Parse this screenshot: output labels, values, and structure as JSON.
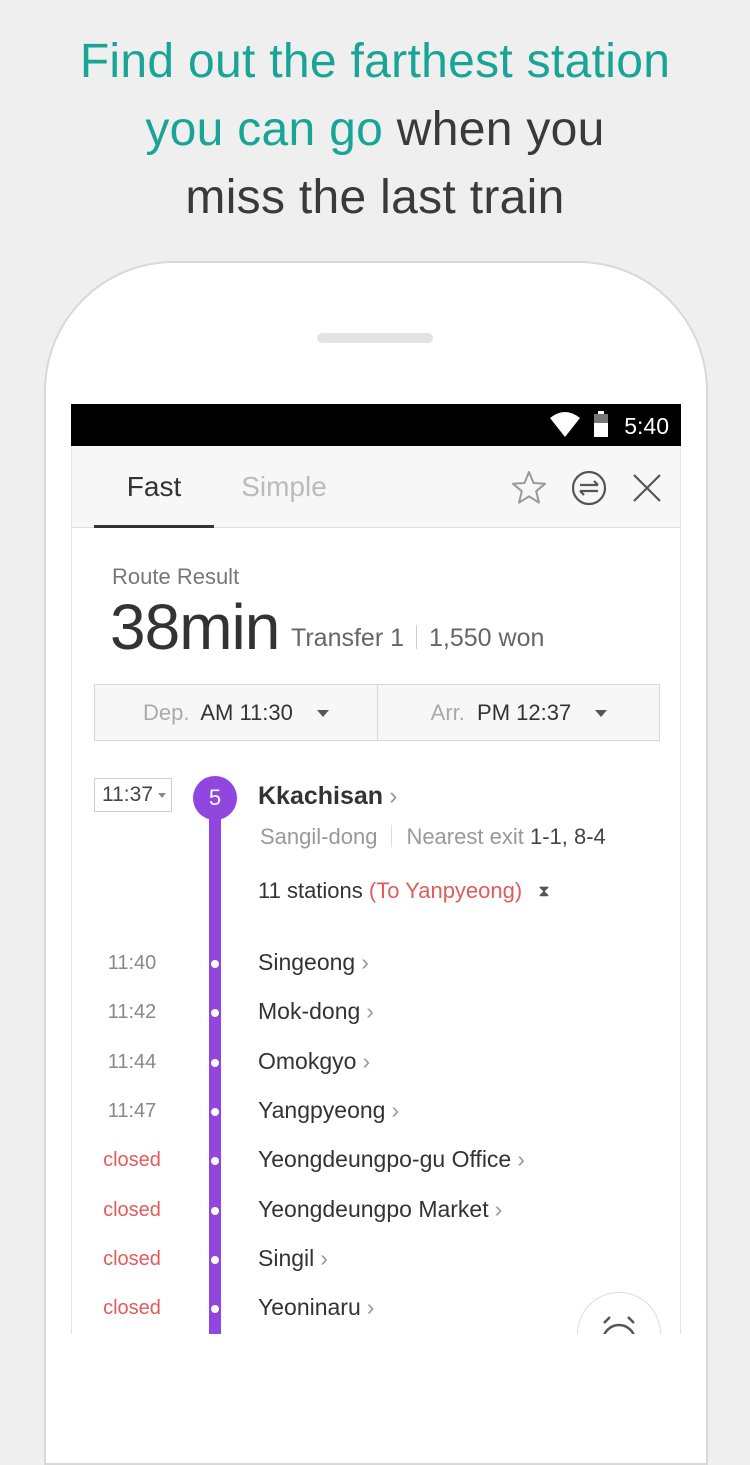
{
  "headline": {
    "line1": "Find out the farthest station",
    "line2_highlight": "you can go",
    "line2_rest": " when you",
    "line3": "miss the last train"
  },
  "status_bar": {
    "time": "5:40"
  },
  "tabs": [
    {
      "label": "Fast",
      "active": true
    },
    {
      "label": "Simple",
      "active": false
    }
  ],
  "toolbar_icons": [
    "star-icon",
    "swap-icon",
    "close-icon"
  ],
  "route": {
    "label": "Route Result",
    "duration": "38min",
    "transfer": "Transfer 1",
    "fare": "1,550 won"
  },
  "times": {
    "dep_label": "Dep.",
    "dep_value": "AM 11:30",
    "arr_label": "Arr.",
    "arr_value": "PM 12:37"
  },
  "boarding": {
    "time": "11:37",
    "line_number": "5",
    "line_color": "#9146e0",
    "station": "Kkachisan",
    "area": "Sangil-dong",
    "exit_label": "Nearest exit",
    "exit_value": "1-1, 8-4",
    "stations_count": "11 stations",
    "direction": "(To Yanpyeong)"
  },
  "stops": [
    {
      "time": "11:40",
      "name": "Singeong",
      "closed": false
    },
    {
      "time": "11:42",
      "name": "Mok-dong",
      "closed": false
    },
    {
      "time": "11:44",
      "name": "Omokgyo",
      "closed": false
    },
    {
      "time": "11:47",
      "name": "Yangpyeong",
      "closed": false
    },
    {
      "time": "closed",
      "name": "Yeongdeungpo-gu Office",
      "closed": true
    },
    {
      "time": "closed",
      "name": "Yeongdeungpo Market",
      "closed": true
    },
    {
      "time": "closed",
      "name": "Singil",
      "closed": true
    },
    {
      "time": "closed",
      "name": "Yeoninaru",
      "closed": true
    }
  ]
}
